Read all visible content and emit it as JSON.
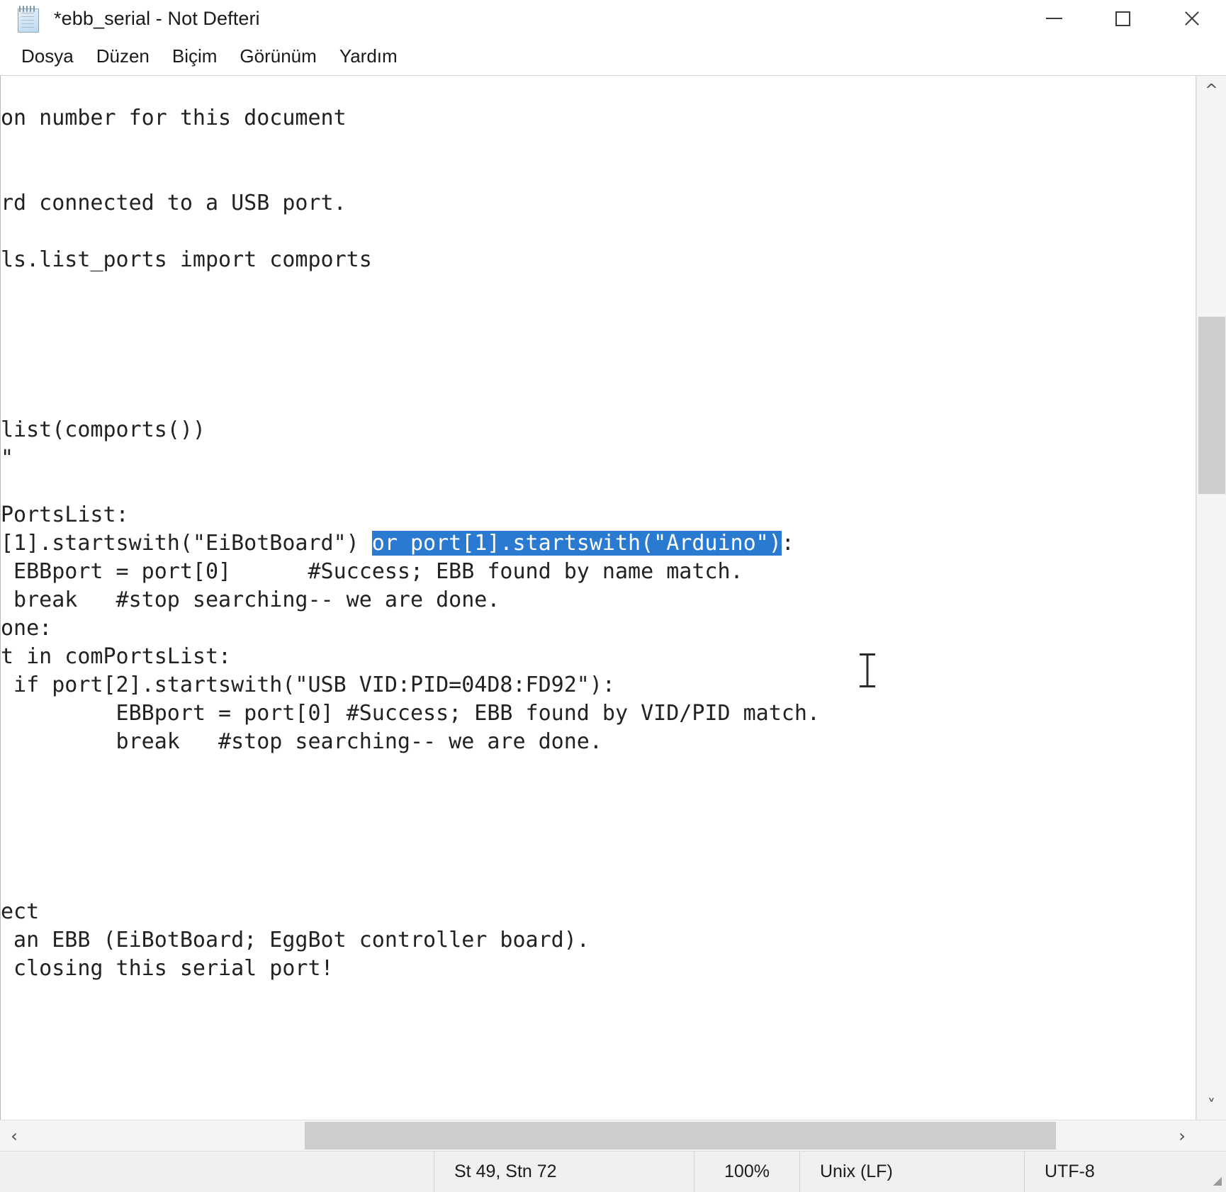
{
  "window": {
    "title": "*ebb_serial - Not Defteri",
    "icon": "notepad-icon",
    "controls": {
      "minimize": "minimize-icon",
      "maximize": "maximize-icon",
      "close": "close-icon"
    }
  },
  "menubar": {
    "items": [
      {
        "label": "Dosya"
      },
      {
        "label": "Düzen"
      },
      {
        "label": "Biçim"
      },
      {
        "label": "Görünüm"
      },
      {
        "label": "Yardım"
      }
    ]
  },
  "editor": {
    "lines_before_selection": "\non number for this document\n\n\nrd connected to a USB port.\n\nls.list_ports import comports\n\n\n\n\n\nlist(comports())\n\"\n\nPortsList:\n[1].startswith(\"EiBotBoard\") ",
    "selected_text": "or port[1].startswith(\"Arduino\")",
    "lines_after_selection": ":\n EBBport = port[0]      #Success; EBB found by name match.\n break   #stop searching-- we are done.\none:\nt in comPortsList:\n if port[2].startswith(\"USB VID:PID=04D8:FD92\"):\n         EBBport = port[0] #Success; EBB found by VID/PID match.\n         break   #stop searching-- we are done.\n\n\n\n\n\nect\n an EBB (EiBotBoard; EggBot controller board).\n closing this serial port!",
    "selection_color": "#2a7ad2",
    "selection_text_color": "#ffffff",
    "text_color": "#222222",
    "background": "#ffffff",
    "cursor": "text-ibeam-cursor"
  },
  "scrollbars": {
    "vertical": {
      "up_arrow": "chevron-up-icon",
      "down_arrow": "chevron-down-icon"
    },
    "horizontal": {
      "left_arrow": "chevron-left-icon",
      "right_arrow": "chevron-right-icon"
    }
  },
  "statusbar": {
    "position": "St 49, Stn 72",
    "zoom": "100%",
    "line_ending": "Unix (LF)",
    "encoding": "UTF-8",
    "resize_grip": "resize-grip-icon"
  }
}
